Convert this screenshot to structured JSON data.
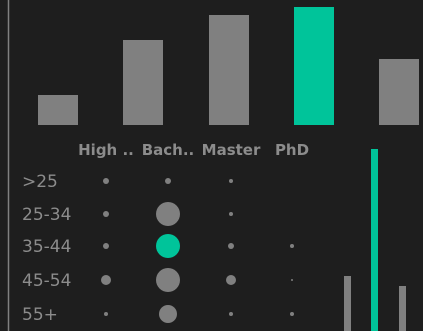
{
  "chart_data": {
    "type": "bar",
    "categories": [
      "High ..",
      "Bach..",
      "Master",
      "PhD",
      ""
    ],
    "top_bars": {
      "values": [
        30,
        85,
        110,
        118,
        66
      ],
      "ylim": [
        0,
        120
      ],
      "highlight_index": 3
    },
    "matrix": {
      "columns": [
        "High ..",
        "Bach..",
        "Master",
        "PhD"
      ],
      "rows": [
        ">25",
        "25-34",
        "35-44",
        "45-54",
        "55+"
      ],
      "sizes": [
        [
          3,
          3,
          2,
          0
        ],
        [
          3,
          12,
          2,
          0
        ],
        [
          3,
          12,
          3,
          2
        ],
        [
          5,
          12,
          5,
          1
        ],
        [
          2,
          9,
          2,
          2
        ]
      ],
      "highlight": [
        2,
        1
      ]
    },
    "side_bars": {
      "values": [
        55,
        182,
        45
      ],
      "ylim": [
        0,
        182
      ],
      "highlight_index": 1
    },
    "colors": {
      "background": "#1e1e1e",
      "bar": "#808080",
      "highlight": "#00c49a",
      "text": "#8c8c8c",
      "axis": "#808080"
    }
  }
}
